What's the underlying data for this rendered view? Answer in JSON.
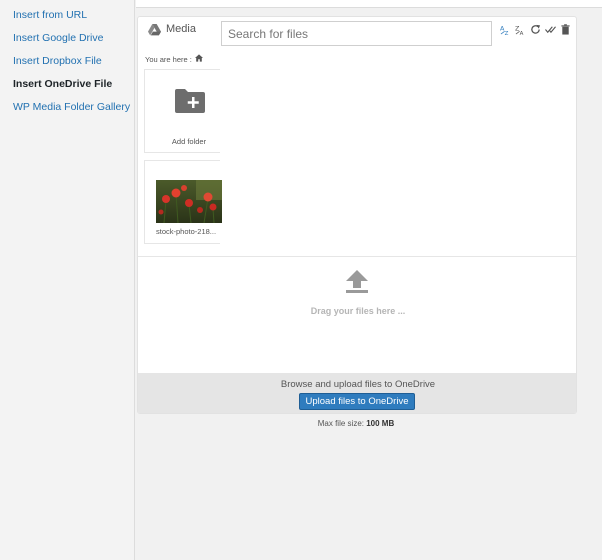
{
  "sidebar": {
    "items": [
      {
        "label": "Insert from URL",
        "active": false
      },
      {
        "label": "Insert Google Drive",
        "active": false
      },
      {
        "label": "Insert Dropbox File",
        "active": false
      },
      {
        "label": "Insert OneDrive File",
        "active": true
      },
      {
        "label": "WP Media Folder Gallery",
        "active": false
      }
    ]
  },
  "browser": {
    "root_title": "Media",
    "search_placeholder": "Search for files",
    "breadcrumb_prefix": "You are here :",
    "toolbar_icons": [
      "sort-az-icon",
      "sort-za-icon",
      "refresh-icon",
      "select-all-icon",
      "trash-icon"
    ],
    "items": [
      {
        "type": "folder",
        "label": "Add folder"
      },
      {
        "type": "image",
        "label": "stock-photo-218..."
      }
    ]
  },
  "dropzone": {
    "text": "Drag your files here ..."
  },
  "upload": {
    "browse_text": "Browse and upload files to OneDrive",
    "button_label": "Upload files to OneDrive",
    "max_size_label": "Max file size:",
    "max_size_value": "100 MB"
  },
  "colors": {
    "link": "#2271b1",
    "button": "#2f7cbe",
    "drop_text": "#b5b5b5"
  }
}
